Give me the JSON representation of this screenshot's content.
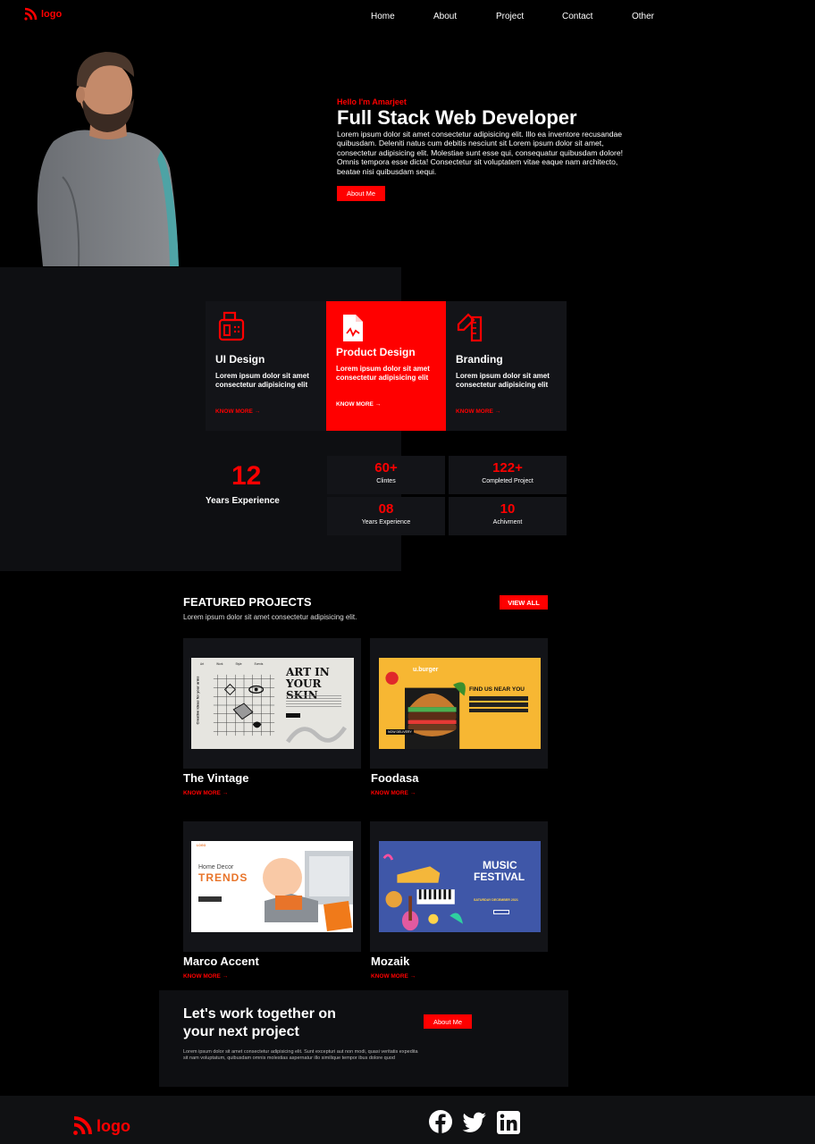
{
  "nav": {
    "logo_text": "logo",
    "links": [
      "Home",
      "About",
      "Project",
      "Contact",
      "Other"
    ]
  },
  "hero": {
    "greeting": "Hello I'm Amarjeet",
    "title": "Full Stack Web Developer",
    "description": "Lorem ipsum dolor sit amet consectetur adipisicing elit. Illo ea inventore recusandae quibusdam. Deleniti natus cum debitis nesciunt sit Lorem ipsum dolor sit amet, consectetur adipisicing elit. Molestiae sunt esse qui, consequatur quibusdam dolore! Omnis tempora esse dicta! Consectetur sit voluptatem vitae eaque nam architecto, beatae nisi quibusdam sequi.",
    "button": "About Me"
  },
  "services": [
    {
      "title": "UI Design",
      "text": "Lorem ipsum dolor sit amet consectetur adipisicing elit",
      "link": "KNOW MORE",
      "icon": "fax-machine-icon"
    },
    {
      "title": "Product Design",
      "text": "Lorem ipsum dolor sit amet consectetur adipisicing elit",
      "link": "KNOW MORE",
      "icon": "document-icon"
    },
    {
      "title": "Branding",
      "text": "Lorem ipsum dolor sit amet consectetur adipisicing elit",
      "link": "KNOW MORE",
      "icon": "pencil-ruler-icon"
    }
  ],
  "experience": {
    "number": "12",
    "label": "Years Experience"
  },
  "stats": [
    {
      "number": "60+",
      "label": "Clintes"
    },
    {
      "number": "122+",
      "label": "Completed Project"
    },
    {
      "number": "08",
      "label": "Years Experience"
    },
    {
      "number": "10",
      "label": "Achivment"
    }
  ],
  "featured": {
    "title": "FEATURED PROJECTS",
    "subtitle": "Lorem ipsum dolor sit amet consectetur adipisicing elit.",
    "view_all": "VIEW ALL",
    "projects": [
      {
        "title": "The Vintage",
        "link": "KNOW MORE",
        "thumb": {
          "nav": [
            "Art",
            "Work",
            "Style",
            "Events"
          ],
          "headline": "ART IN YOUR SKIN",
          "side": "Creative ideas for your arms"
        }
      },
      {
        "title": "Foodasa",
        "link": "KNOW MORE",
        "thumb": {
          "brand": "u.burger",
          "headline": "FIND US NEAR YOU",
          "chip": "NOW DELIVERY"
        }
      },
      {
        "title": "Marco Accent",
        "link": "KNOW MORE",
        "thumb": {
          "brand": "LOGO",
          "eyebrow": "Home Decor",
          "headline": "TRENDS"
        }
      },
      {
        "title": "Mozaik",
        "link": "KNOW MORE",
        "thumb": {
          "headline_1": "MUSIC",
          "headline_2": "FESTIVAL",
          "date": "SATURDAY DECEMBER 2021"
        }
      }
    ]
  },
  "cta": {
    "title_line1": "Let's work together on",
    "title_line2": "your next project",
    "button": "About Me",
    "text": "Lorem ipsum dolor sit amet consectetur adipisicing elit. Sunt excepturi aut non modi, quasi veritatis expedita sit nam voluptatum, quibusdam omnis molestias aspernatur illo similique tempor ibus dolore quod"
  },
  "footer": {
    "logo_text": "logo",
    "social": [
      "facebook-icon",
      "twitter-icon",
      "linkedin-icon"
    ]
  },
  "colors": {
    "accent": "#ff0000",
    "background": "#000000",
    "panel": "#131418"
  }
}
